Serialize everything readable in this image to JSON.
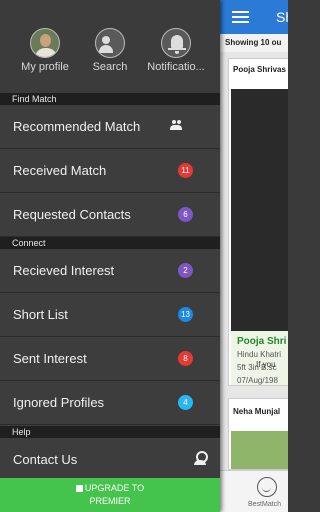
{
  "main": {
    "title": "Sh",
    "showing_text": "Showing 10 ou",
    "card1": {
      "top_name": "Pooja Shrivas",
      "name": "Pooja Shri",
      "line1": "Hindu Khatri",
      "line2": "5ft 3in B.sc",
      "line3": "07/Aug/198",
      "if_text": "If you"
    },
    "card2": {
      "top_name": "Neha Munjal"
    },
    "bottom": {
      "label": "BestMatch"
    }
  },
  "drawer": {
    "top": {
      "profile_label": "My profile",
      "search_label": "Search",
      "notifications_label": "Notificatio..."
    },
    "sections": {
      "find_match": "Find Match",
      "connect": "Connect",
      "help": "Help"
    },
    "items": {
      "recommended": "Recommended Match",
      "received": "Received Match",
      "received_count": "11",
      "requested": "Requested Contacts",
      "requested_count": "6",
      "recieved_interest": "Recieved Interest",
      "recieved_interest_count": "2",
      "short_list": "Short List",
      "short_list_count": "13",
      "sent_interest": "Sent Interest",
      "sent_interest_count": "8",
      "ignored": "Ignored Profiles",
      "ignored_count": "4",
      "contact_us": "Contact Us"
    },
    "upgrade_line1": "UPGRADE TO",
    "upgrade_line2": "PREMIER"
  },
  "colors": {
    "badge_red": "#e53935",
    "badge_purple": "#7e57c2",
    "badge_blue": "#1e88e5",
    "badge_cyan": "#29b6f6",
    "upgrade_green": "#45c44d",
    "toolbar_blue": "#2b7bd6"
  }
}
